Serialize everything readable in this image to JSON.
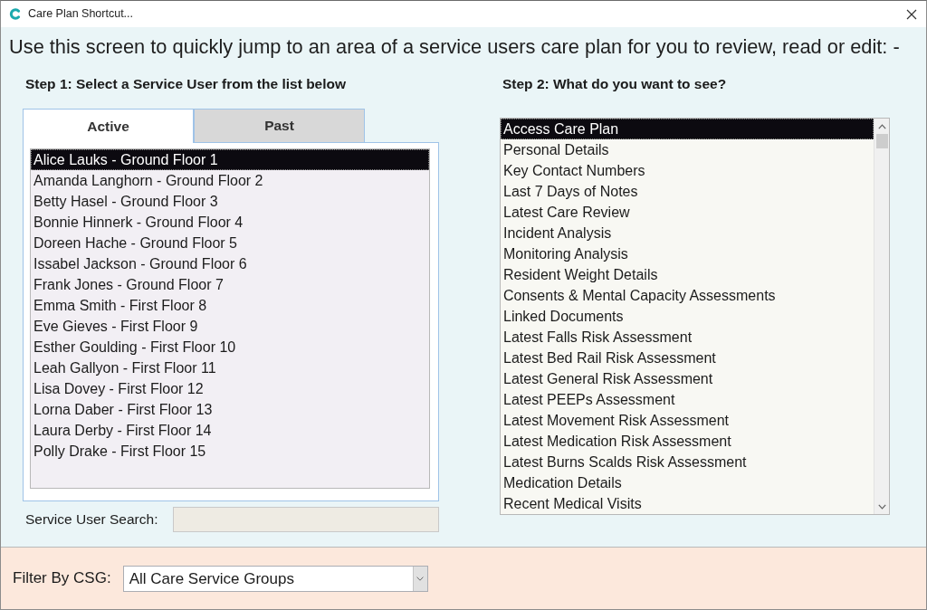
{
  "window": {
    "title": "Care Plan Shortcut..."
  },
  "instructions": "Use this screen to quickly jump to an area of a service users care plan for you to review, read or edit: -",
  "step_1": {
    "label": "Step 1: Select a Service User from the list below",
    "tabs": [
      {
        "label": "Active",
        "selected": true
      },
      {
        "label": "Past",
        "selected": false
      }
    ],
    "service_users": [
      {
        "label": "Alice Lauks - Ground Floor 1",
        "selected": true
      },
      {
        "label": "Amanda Langhorn - Ground Floor 2",
        "selected": false
      },
      {
        "label": "Betty Hasel - Ground Floor 3",
        "selected": false
      },
      {
        "label": "Bonnie Hinnerk - Ground Floor 4",
        "selected": false
      },
      {
        "label": "Doreen Hache - Ground Floor 5",
        "selected": false
      },
      {
        "label": "Issabel Jackson - Ground Floor 6",
        "selected": false
      },
      {
        "label": "Frank Jones - Ground Floor 7",
        "selected": false
      },
      {
        "label": "Emma Smith - First Floor 8",
        "selected": false
      },
      {
        "label": "Eve Gieves - First Floor 9",
        "selected": false
      },
      {
        "label": "Esther Goulding - First Floor 10",
        "selected": false
      },
      {
        "label": "Leah Gallyon - First Floor 11",
        "selected": false
      },
      {
        "label": "Lisa Dovey - First Floor 12",
        "selected": false
      },
      {
        "label": "Lorna Daber - First Floor 13",
        "selected": false
      },
      {
        "label": "Laura Derby - First Floor 14",
        "selected": false
      },
      {
        "label": "Polly Drake - First Floor 15",
        "selected": false
      }
    ],
    "search": {
      "label": "Service User Search:"
    }
  },
  "step_2": {
    "label": "Step 2: What do you want to see?",
    "options": [
      {
        "label": "Access Care Plan",
        "selected": true
      },
      {
        "label": "Personal Details",
        "selected": false
      },
      {
        "label": "Key Contact Numbers",
        "selected": false
      },
      {
        "label": "Last 7 Days of Notes",
        "selected": false
      },
      {
        "label": "Latest Care Review",
        "selected": false
      },
      {
        "label": "Incident Analysis",
        "selected": false
      },
      {
        "label": "Monitoring Analysis",
        "selected": false
      },
      {
        "label": "Resident Weight Details",
        "selected": false
      },
      {
        "label": "Consents & Mental Capacity Assessments",
        "selected": false
      },
      {
        "label": "Linked Documents",
        "selected": false
      },
      {
        "label": "Latest Falls Risk Assessment",
        "selected": false
      },
      {
        "label": "Latest Bed Rail Risk Assessment",
        "selected": false
      },
      {
        "label": "Latest General Risk Assessment",
        "selected": false
      },
      {
        "label": "Latest PEEPs Assessment",
        "selected": false
      },
      {
        "label": "Latest Movement Risk Assessment",
        "selected": false
      },
      {
        "label": "Latest Medication Risk Assessment",
        "selected": false
      },
      {
        "label": "Latest Burns Scalds Risk Assessment",
        "selected": false
      },
      {
        "label": "Medication Details",
        "selected": false
      },
      {
        "label": "Recent Medical Visits",
        "selected": false
      }
    ]
  },
  "filter": {
    "label": "Filter By CSG:",
    "value": "All Care Service Groups"
  }
}
